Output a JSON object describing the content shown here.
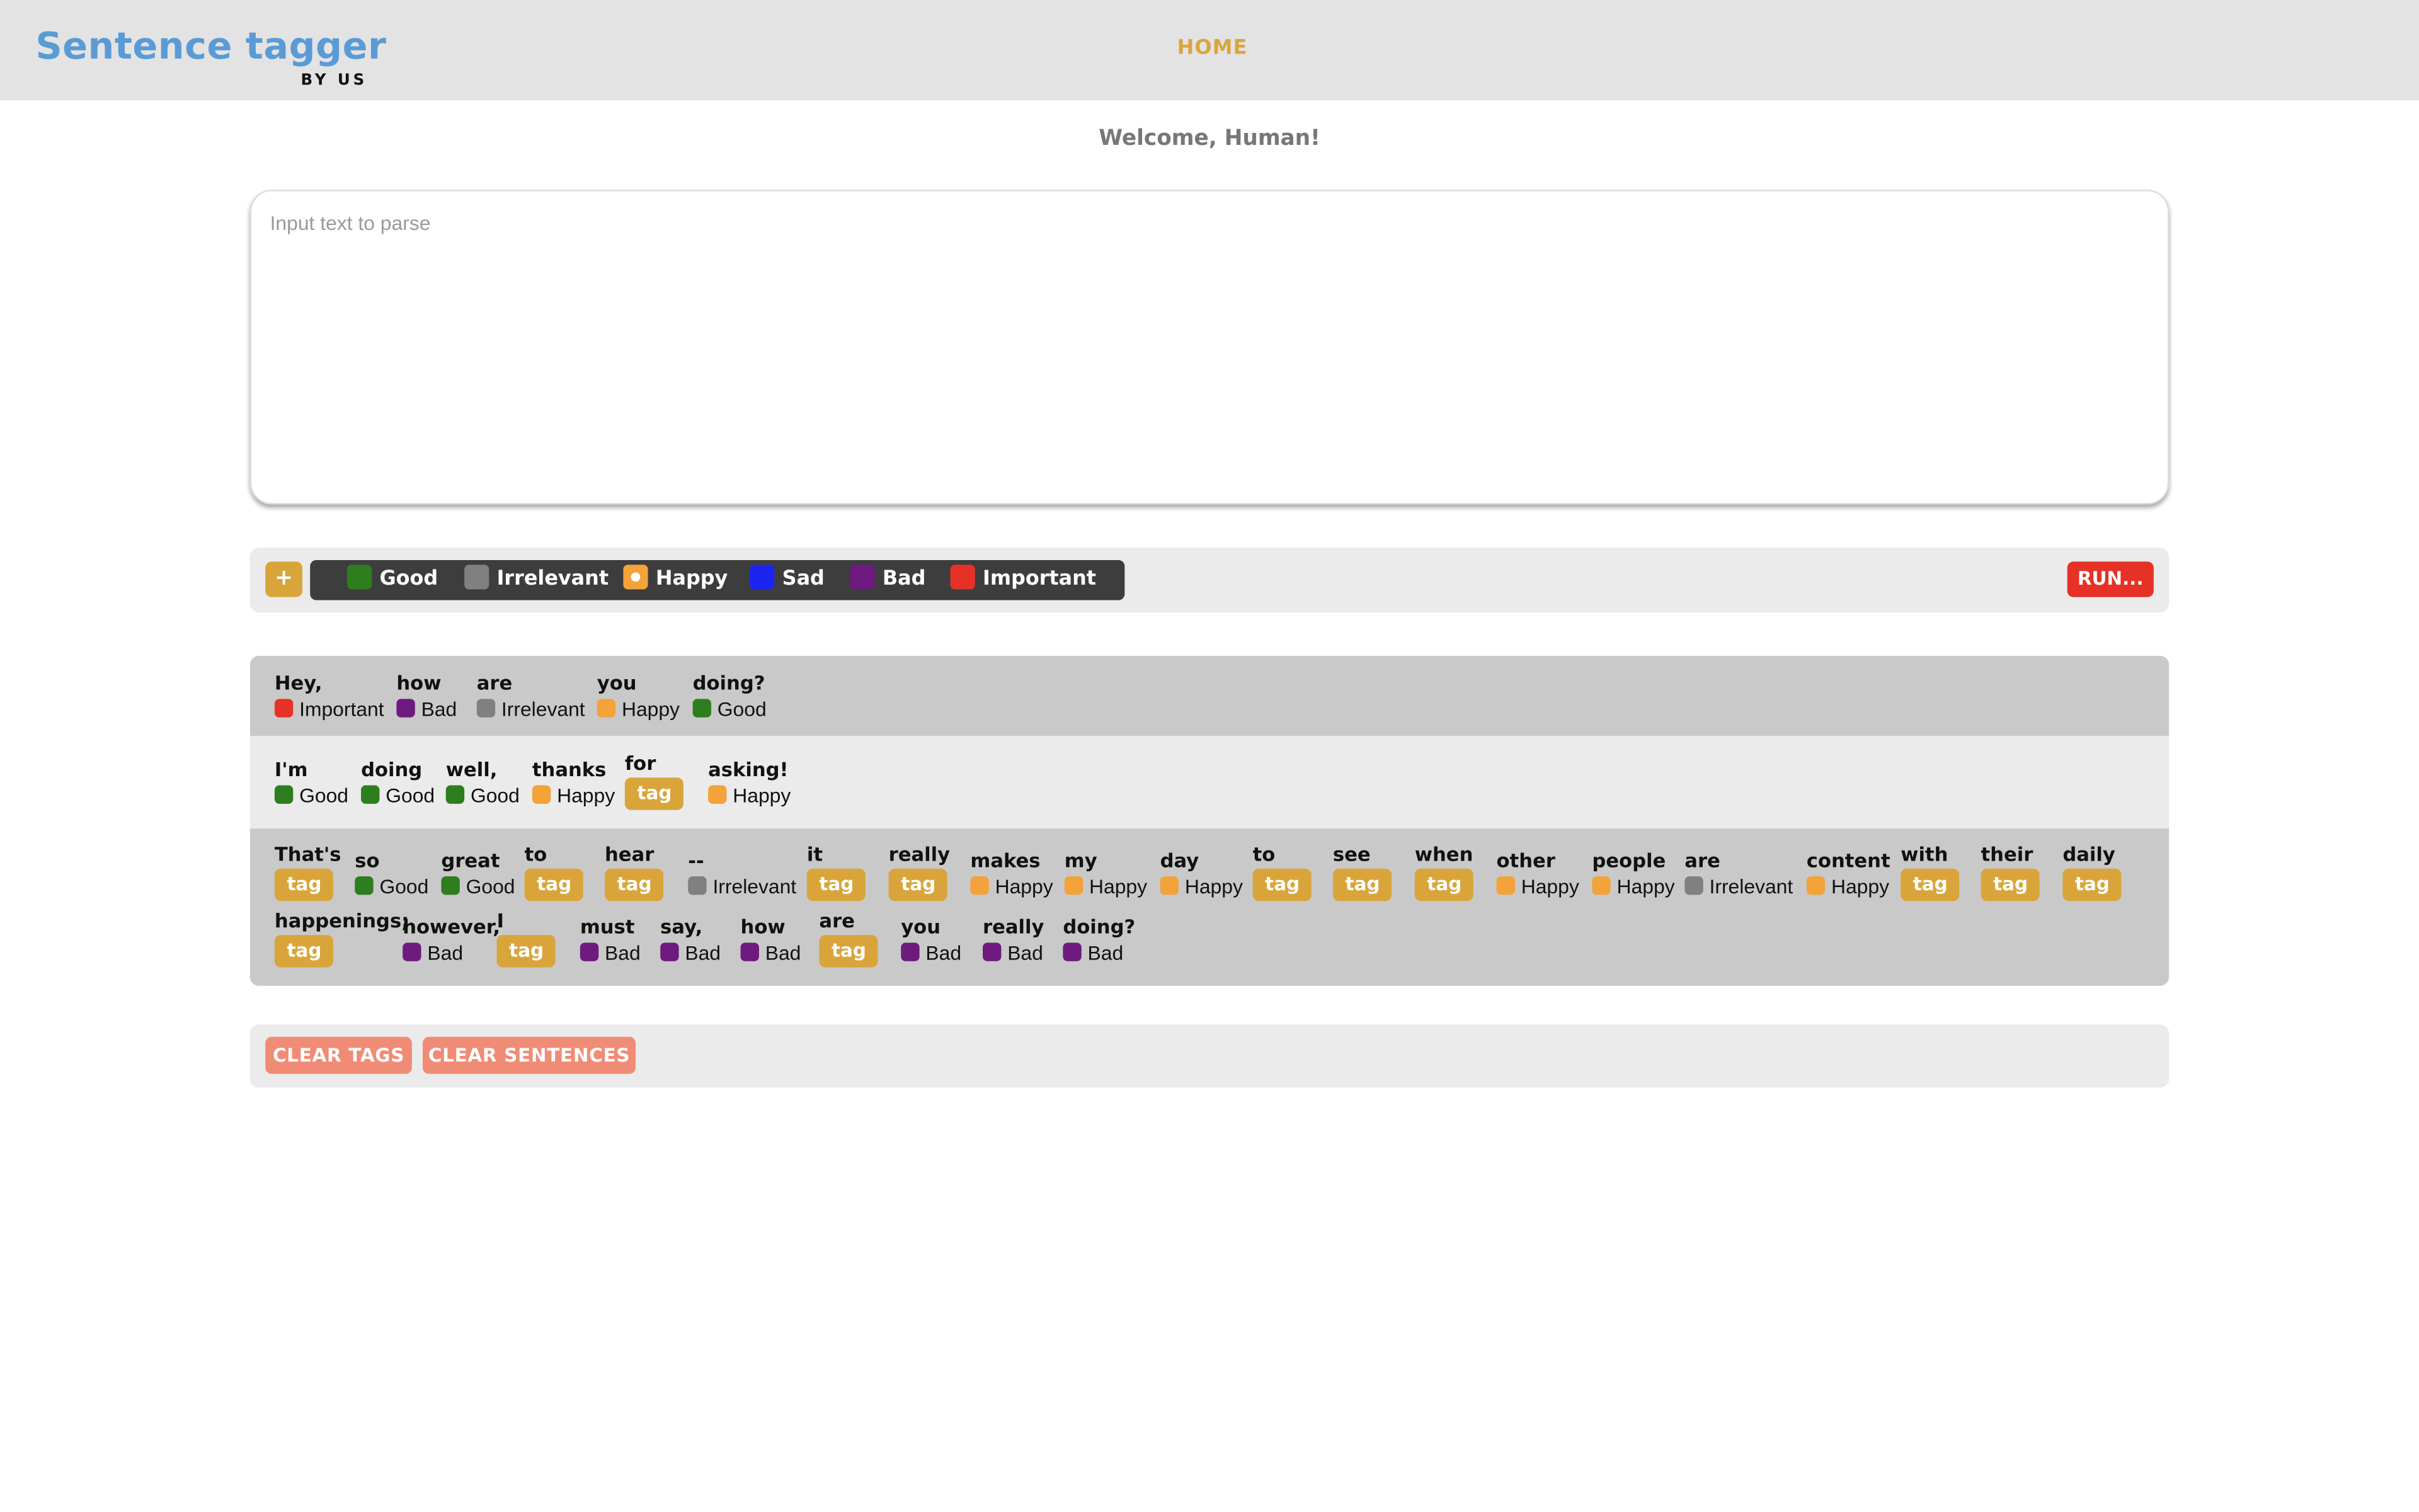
{
  "header": {
    "logo_title": "Sentence tagger",
    "logo_subtitle": "BY US",
    "nav_home": "HOME"
  },
  "welcome": "Welcome, Human!",
  "input": {
    "placeholder": "Input text to parse",
    "value": ""
  },
  "toolbar": {
    "add_label": "+",
    "run_label": "RUN...",
    "tags": [
      {
        "name": "Good",
        "color": "#2e7d1f",
        "selected": false
      },
      {
        "name": "Irrelevant",
        "color": "#808080",
        "selected": false
      },
      {
        "name": "Happy",
        "color": "#f4a23a",
        "selected": true
      },
      {
        "name": "Sad",
        "color": "#1c24f0",
        "selected": false
      },
      {
        "name": "Bad",
        "color": "#6e1a7e",
        "selected": false
      },
      {
        "name": "Important",
        "color": "#e63226",
        "selected": false
      }
    ]
  },
  "tag_colors": {
    "Good": "#2e7d1f",
    "Irrelevant": "#808080",
    "Happy": "#f4a23a",
    "Sad": "#1c24f0",
    "Bad": "#6e1a7e",
    "Important": "#e63226"
  },
  "untagged_label": "tag",
  "sentences": [
    [
      {
        "word": "Hey,",
        "tag": "Important"
      },
      {
        "word": "how",
        "tag": "Bad"
      },
      {
        "word": "are",
        "tag": "Irrelevant"
      },
      {
        "word": "you",
        "tag": "Happy"
      },
      {
        "word": "doing?",
        "tag": "Good"
      }
    ],
    [
      {
        "word": "I'm",
        "tag": "Good"
      },
      {
        "word": "doing",
        "tag": "Good"
      },
      {
        "word": "well,",
        "tag": "Good"
      },
      {
        "word": "thanks",
        "tag": "Happy"
      },
      {
        "word": "for",
        "tag": null
      },
      {
        "word": "asking!",
        "tag": "Happy"
      }
    ],
    [
      {
        "word": "That's",
        "tag": null
      },
      {
        "word": "so",
        "tag": "Good"
      },
      {
        "word": "great",
        "tag": "Good"
      },
      {
        "word": "to",
        "tag": null
      },
      {
        "word": "hear",
        "tag": null
      },
      {
        "word": "--",
        "tag": "Irrelevant"
      },
      {
        "word": "it",
        "tag": null
      },
      {
        "word": "really",
        "tag": null
      },
      {
        "word": "makes",
        "tag": "Happy"
      },
      {
        "word": "my",
        "tag": "Happy"
      },
      {
        "word": "day",
        "tag": "Happy"
      },
      {
        "word": "to",
        "tag": null
      },
      {
        "word": "see",
        "tag": null
      },
      {
        "word": "when",
        "tag": null
      },
      {
        "word": "other",
        "tag": "Happy"
      },
      {
        "word": "people",
        "tag": "Happy"
      },
      {
        "word": "are",
        "tag": "Irrelevant"
      },
      {
        "word": "content",
        "tag": "Happy"
      },
      {
        "word": "with",
        "tag": null
      },
      {
        "word": "their",
        "tag": null
      },
      {
        "word": "daily",
        "tag": null
      },
      {
        "word": "happenings;",
        "tag": null
      },
      {
        "word": "however,",
        "tag": "Bad"
      },
      {
        "word": "I",
        "tag": null
      },
      {
        "word": "must",
        "tag": "Bad"
      },
      {
        "word": "say,",
        "tag": "Bad"
      },
      {
        "word": "how",
        "tag": "Bad"
      },
      {
        "word": "are",
        "tag": null
      },
      {
        "word": "you",
        "tag": "Bad"
      },
      {
        "word": "really",
        "tag": "Bad"
      },
      {
        "word": "doing?",
        "tag": "Bad"
      }
    ]
  ],
  "bottom": {
    "clear_tags": "CLEAR TAGS",
    "clear_sentences": "CLEAR SENTENCES"
  }
}
